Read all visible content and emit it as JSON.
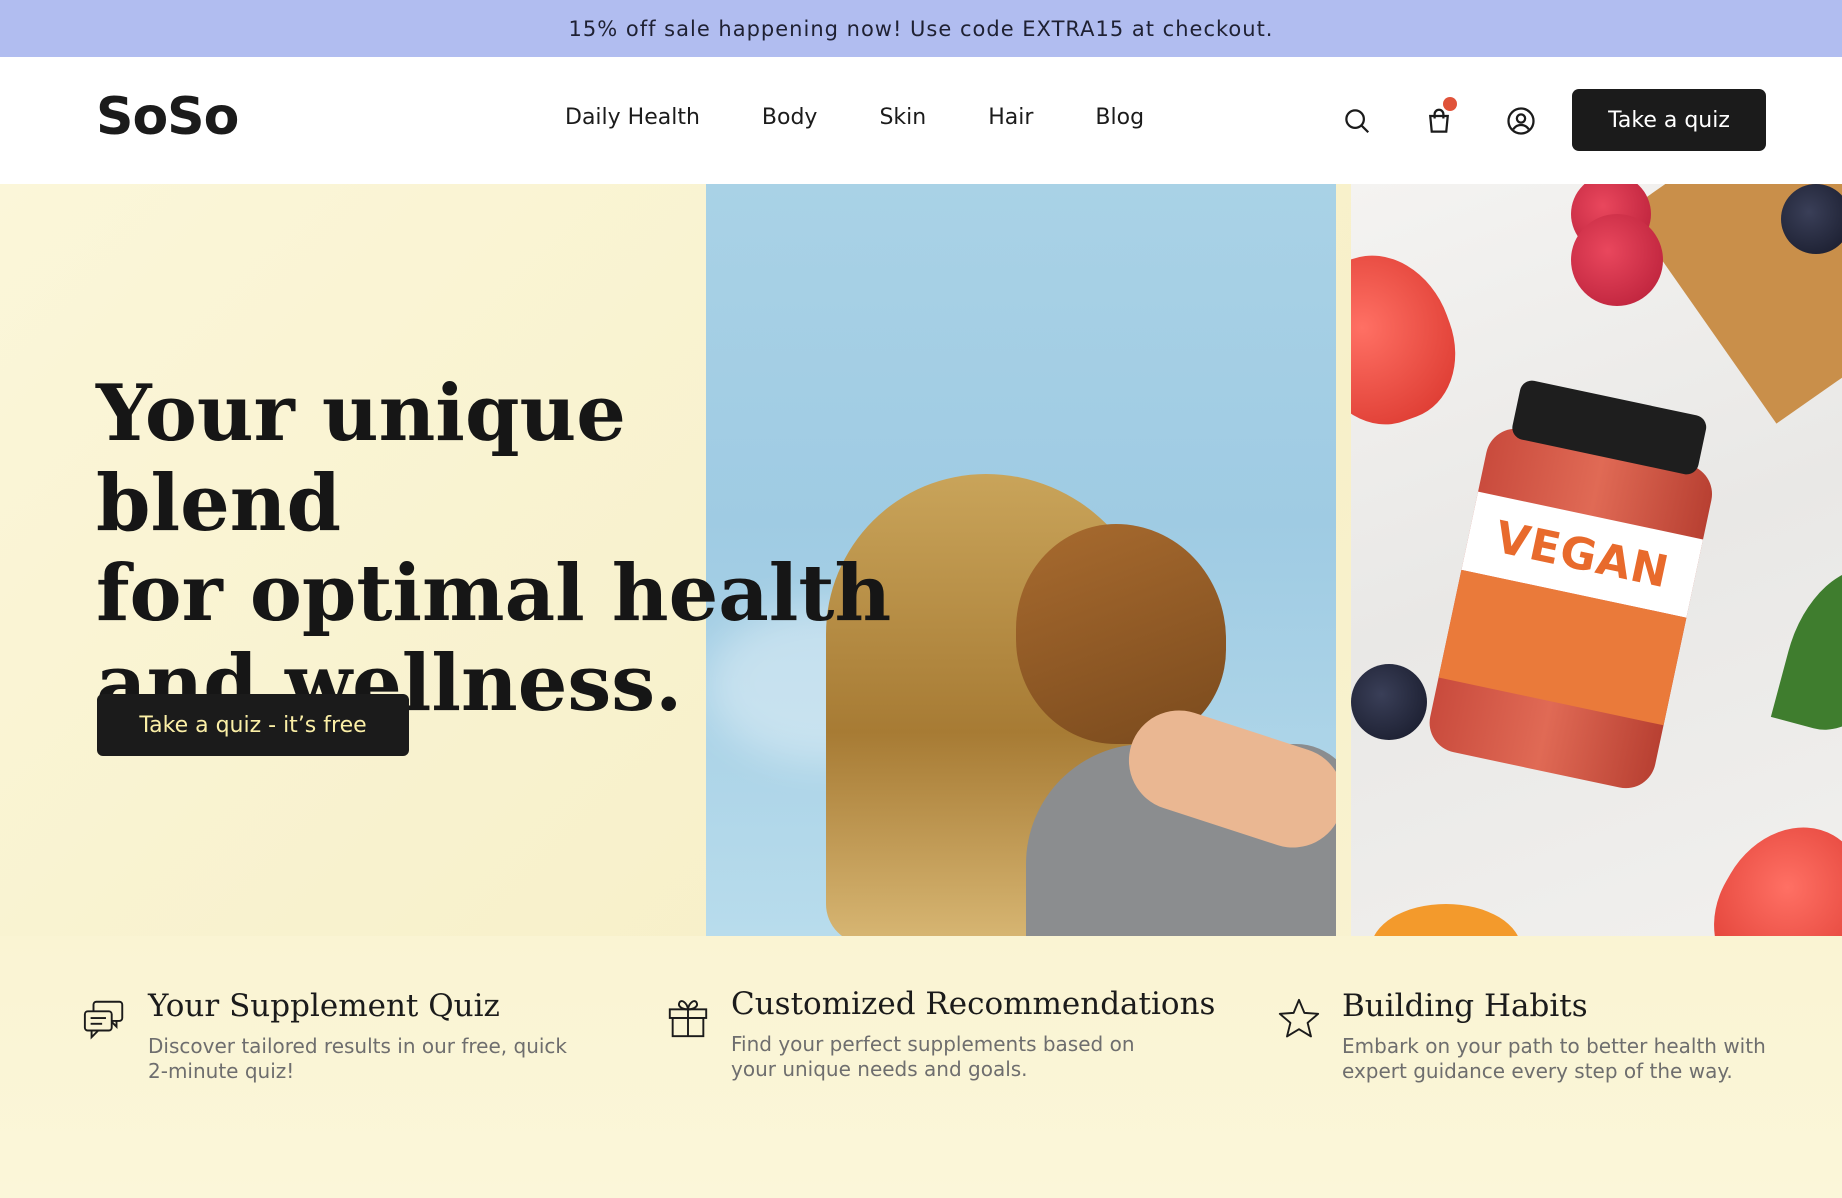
{
  "promo": {
    "text": "15% off sale happening now! Use code EXTRA15 at checkout."
  },
  "header": {
    "logo": "SoSo",
    "nav": [
      "Daily Health",
      "Body",
      "Skin",
      "Hair",
      "Blog"
    ],
    "icons": {
      "search": "search-icon",
      "cart": "shopping-bag-icon",
      "account": "user-circle-icon"
    },
    "cta": "Take a quiz"
  },
  "hero": {
    "title_line1": "Your unique blend",
    "title_line2": "for optimal health",
    "title_line3": "and wellness.",
    "cta": "Take a quiz - it’s free",
    "bottle_label": "VEGAN"
  },
  "features": [
    {
      "icon": "chat-bubbles-icon",
      "title": "Your Supplement Quiz",
      "text": "Discover tailored results in our free, quick 2-minute quiz!"
    },
    {
      "icon": "gift-icon",
      "title": "Customized Recommendations",
      "text": "Find your perfect supplements based on your unique needs and goals."
    },
    {
      "icon": "star-icon",
      "title": "Building Habits",
      "text": "Embark on your path to better health with expert guidance every step of the way."
    }
  ],
  "colors": {
    "promo_bg": "#b1bdf0",
    "dark": "#1b1b1b",
    "cart_dot": "#e0533a",
    "hero_bg": "#fbf6d9",
    "cta_text": "#fbefa6"
  }
}
